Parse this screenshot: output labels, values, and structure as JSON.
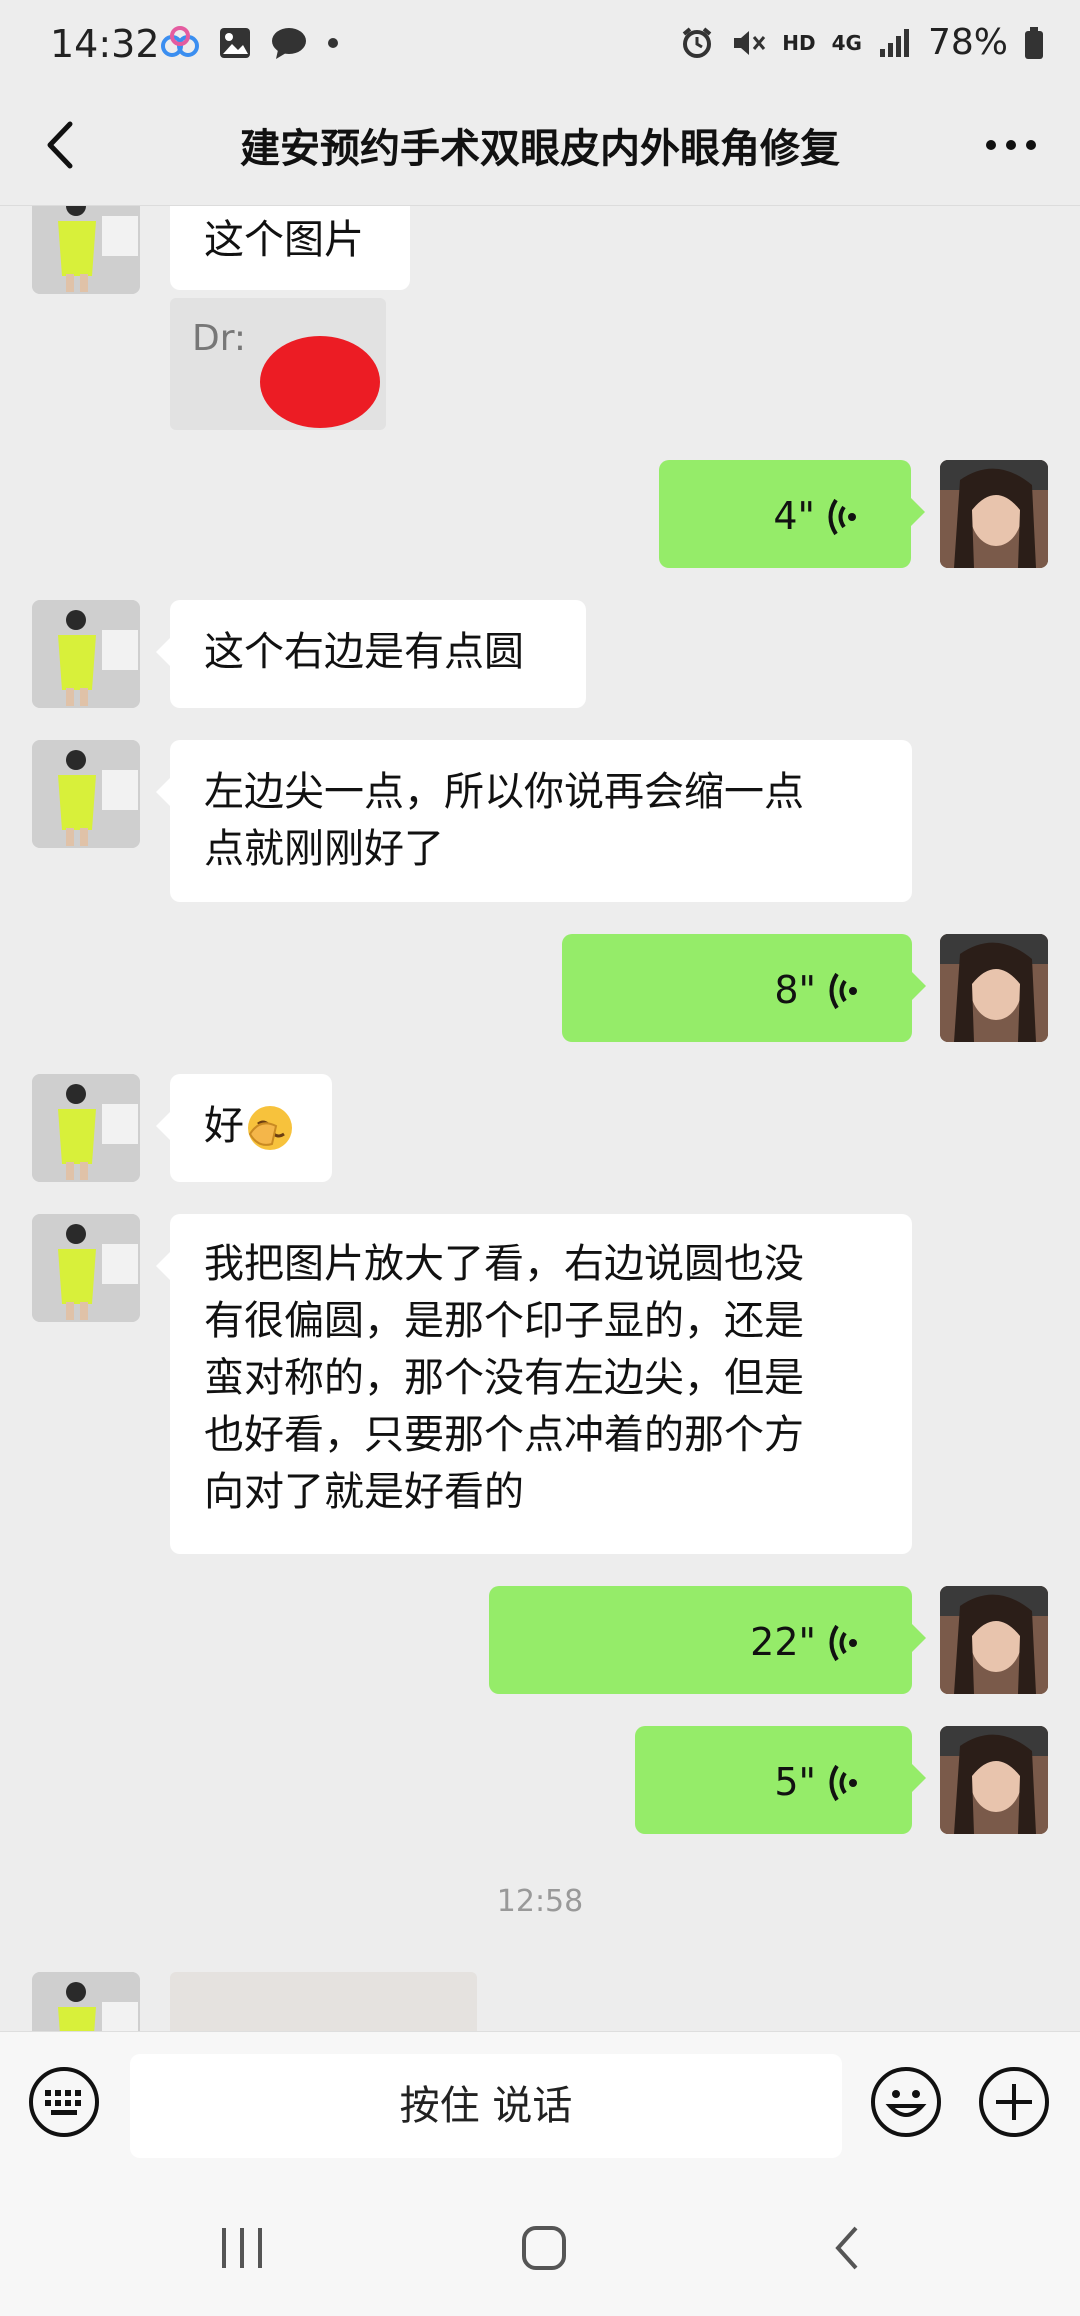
{
  "status_bar": {
    "time": "14:32",
    "network": "HD",
    "network_type": "4G",
    "battery": "78%"
  },
  "header": {
    "title": "建安预约手术双眼皮内外眼角修复"
  },
  "messages": [
    {
      "side": "left",
      "type": "text",
      "text": "这个图片"
    },
    {
      "side": "left",
      "type": "image",
      "caption": "Dr:"
    },
    {
      "side": "right",
      "type": "voice",
      "duration": "4\""
    },
    {
      "side": "left",
      "type": "text",
      "text": "这个右边是有点圆"
    },
    {
      "side": "left",
      "type": "text",
      "lines": [
        "左边尖一点，所以你说再会缩一点",
        "点就刚刚好了"
      ]
    },
    {
      "side": "right",
      "type": "voice",
      "duration": "8\""
    },
    {
      "side": "left",
      "type": "text",
      "text": "好"
    },
    {
      "side": "left",
      "type": "text",
      "lines": [
        "我把图片放大了看，右边说圆也没",
        "有很偏圆，是那个印子显的，还是",
        "蛮对称的，那个没有左边尖，但是",
        "也好看，只要那个点冲着的那个方",
        "向对了就是好看的"
      ]
    },
    {
      "side": "right",
      "type": "voice",
      "duration": "22\""
    },
    {
      "side": "right",
      "type": "voice",
      "duration": "5\""
    }
  ],
  "timestamp": "12:58",
  "input_bar": {
    "hold_to_talk": "按住 说话"
  },
  "colors": {
    "background": "#ededed",
    "bubble_self": "#95ec69",
    "bubble_other": "#ffffff"
  }
}
